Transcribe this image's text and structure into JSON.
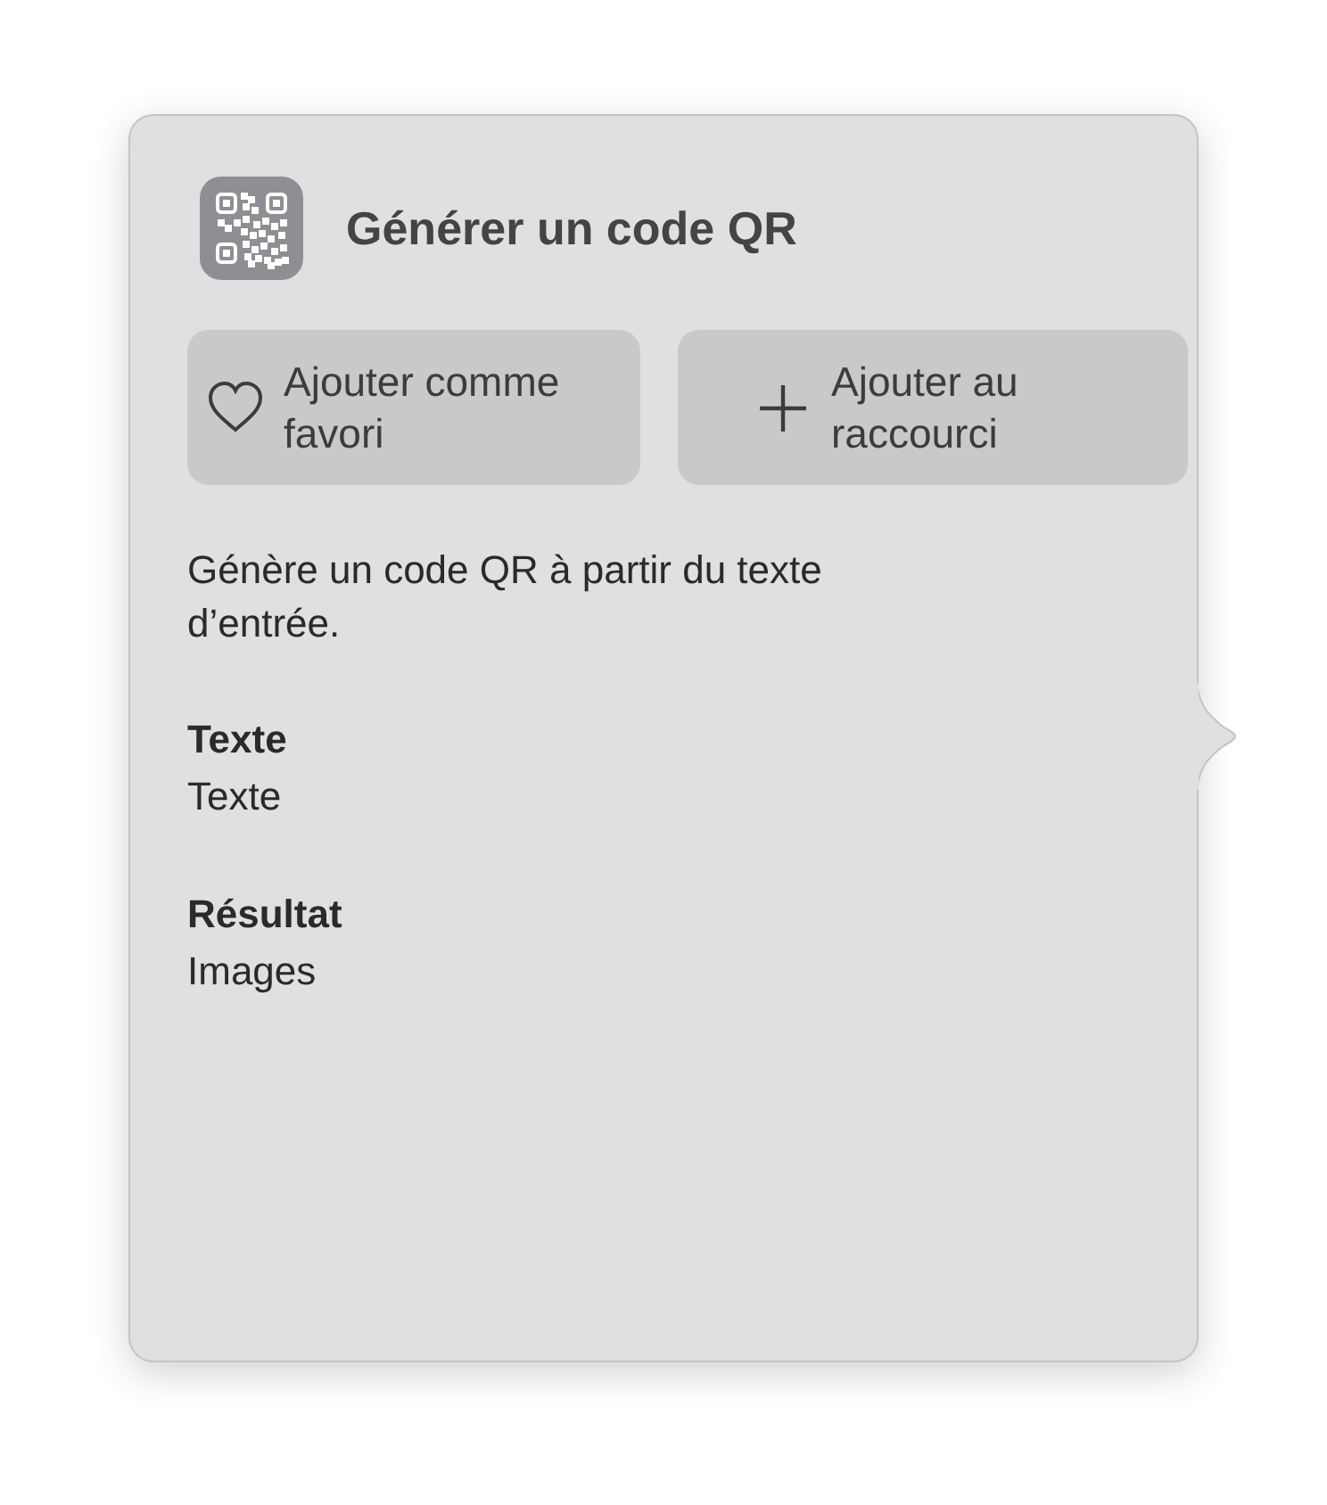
{
  "popover": {
    "title": "Générer un code QR",
    "buttons": [
      {
        "kind": "favorite",
        "label": "Ajouter comme favori"
      },
      {
        "kind": "add",
        "label": "Ajouter au raccourci"
      }
    ],
    "description": "Génère un code QR à partir du texte d’entrée.",
    "sections": [
      {
        "label": "Texte",
        "value": "Texte"
      },
      {
        "label": "Résultat",
        "value": "Images"
      }
    ]
  }
}
